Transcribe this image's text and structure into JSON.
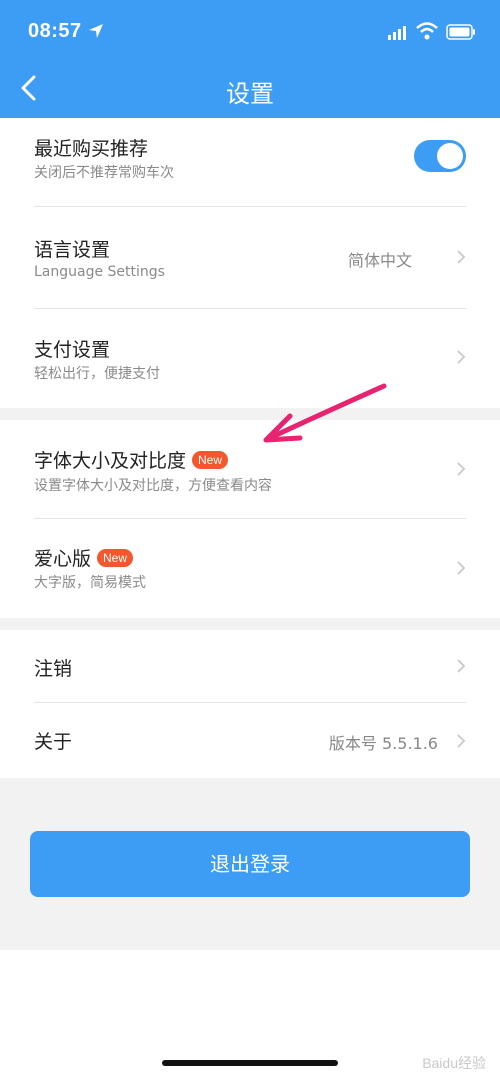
{
  "status_bar": {
    "time": "08:57"
  },
  "header": {
    "title": "设置"
  },
  "settings": {
    "recent_purchase": {
      "title": "最近购买推荐",
      "subtitle": "关闭后不推荐常购车次",
      "toggle_on": true
    },
    "language": {
      "title": "语言设置",
      "subtitle": "Language Settings",
      "value": "简体中文"
    },
    "payment": {
      "title": "支付设置",
      "subtitle": "轻松出行，便捷支付"
    },
    "font_size": {
      "title": "字体大小及对比度",
      "badge": "New",
      "subtitle": "设置字体大小及对比度，方便查看内容"
    },
    "care_mode": {
      "title": "爱心版",
      "badge": "New",
      "subtitle": "大字版，简易模式"
    },
    "deregister": {
      "title": "注销"
    },
    "about": {
      "title": "关于",
      "value": "版本号 5.5.1.6"
    }
  },
  "logout_label": "退出登录",
  "watermark": "Baidu经验",
  "colors": {
    "accent": "#3d9df4",
    "badge": "#f3572d",
    "annotation": "#e8236f"
  }
}
